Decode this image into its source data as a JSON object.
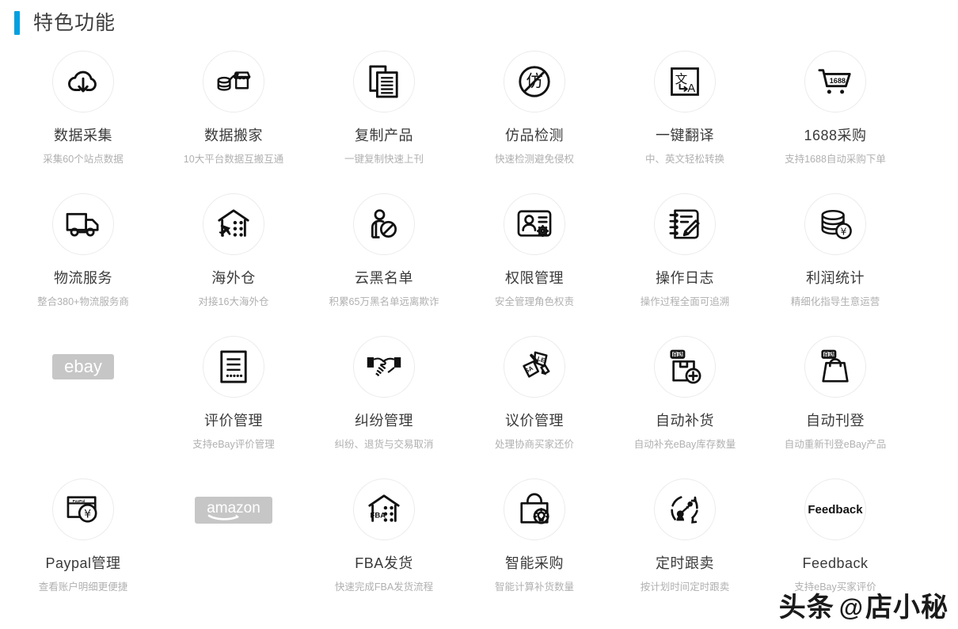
{
  "header": {
    "title": "特色功能",
    "accent_color": "#00a0e0"
  },
  "features": [
    {
      "icon": "cloud-download-icon",
      "title": "数据采集",
      "subtitle": "采集60个站点数据"
    },
    {
      "icon": "database-shop-icon",
      "title": "数据搬家",
      "subtitle": "10大平台数据互搬互通"
    },
    {
      "icon": "copy-documents-icon",
      "title": "复制产品",
      "subtitle": "一键复制快速上刊"
    },
    {
      "icon": "counterfeit-ban-icon",
      "title": "仿品检测",
      "subtitle": "快速检测避免侵权"
    },
    {
      "icon": "translate-icon",
      "title": "一键翻译",
      "subtitle": "中、英文轻松转换"
    },
    {
      "icon": "cart-1688-icon",
      "title": "1688采购",
      "subtitle": "支持1688自动采购下单"
    },
    {
      "icon": "truck-icon",
      "title": "物流服务",
      "subtitle": "整合380+物流服务商"
    },
    {
      "icon": "overseas-warehouse-icon",
      "title": "海外仓",
      "subtitle": "对接16大海外仓"
    },
    {
      "icon": "blacklist-user-icon",
      "title": "云黑名单",
      "subtitle": "积累65万黑名单远离欺诈"
    },
    {
      "icon": "user-permission-icon",
      "title": "权限管理",
      "subtitle": "安全管理角色权责"
    },
    {
      "icon": "notebook-pencil-icon",
      "title": "操作日志",
      "subtitle": "操作过程全面可追溯"
    },
    {
      "icon": "coins-yen-icon",
      "title": "利润统计",
      "subtitle": "精细化指导生意运营"
    },
    {
      "icon": "ebay-logo",
      "title": "",
      "subtitle": "",
      "brand": "ebay"
    },
    {
      "icon": "review-document-icon",
      "title": "评价管理",
      "subtitle": "支持eBay评价管理"
    },
    {
      "icon": "handshake-icon",
      "title": "纠纷管理",
      "subtitle": "纠纷、退货与交易取消"
    },
    {
      "icon": "price-tags-icon",
      "title": "议价管理",
      "subtitle": "处理协商买家还价"
    },
    {
      "icon": "auto-restock-box-icon",
      "title": "自动补货",
      "subtitle": "自动补充eBay库存数量"
    },
    {
      "icon": "auto-listing-bag-icon",
      "title": "自动刊登",
      "subtitle": "自动重新刊登eBay产品"
    },
    {
      "icon": "paypal-card-icon",
      "title": "Paypal管理",
      "subtitle": "查看账户明细更便捷"
    },
    {
      "icon": "amazon-logo",
      "title": "",
      "subtitle": "",
      "brand": "amazon"
    },
    {
      "icon": "fba-warehouse-icon",
      "title": "FBA发货",
      "subtitle": "快速完成FBA发货流程"
    },
    {
      "icon": "smart-purchase-icon",
      "title": "智能采购",
      "subtitle": "智能计算补货数量"
    },
    {
      "icon": "scheduled-follow-icon",
      "title": "定时跟卖",
      "subtitle": "按计划时间定时跟卖"
    },
    {
      "icon": "feedback-icon",
      "title": "Feedback",
      "subtitle": "支持eBay买家评价"
    }
  ],
  "icon_labels": {
    "cart_1688": "1688",
    "translate_cn": "文",
    "translate_en": "A",
    "counterfeit": "仿",
    "fba": "FBA",
    "auto_badge": "自动",
    "feedback": "Feedback",
    "paypal": "PayPal",
    "yen": "¥",
    "ebay": "ebay",
    "amazon": "amazon"
  },
  "watermark": {
    "brand": "头条",
    "at": "@",
    "account": "店小秘"
  }
}
